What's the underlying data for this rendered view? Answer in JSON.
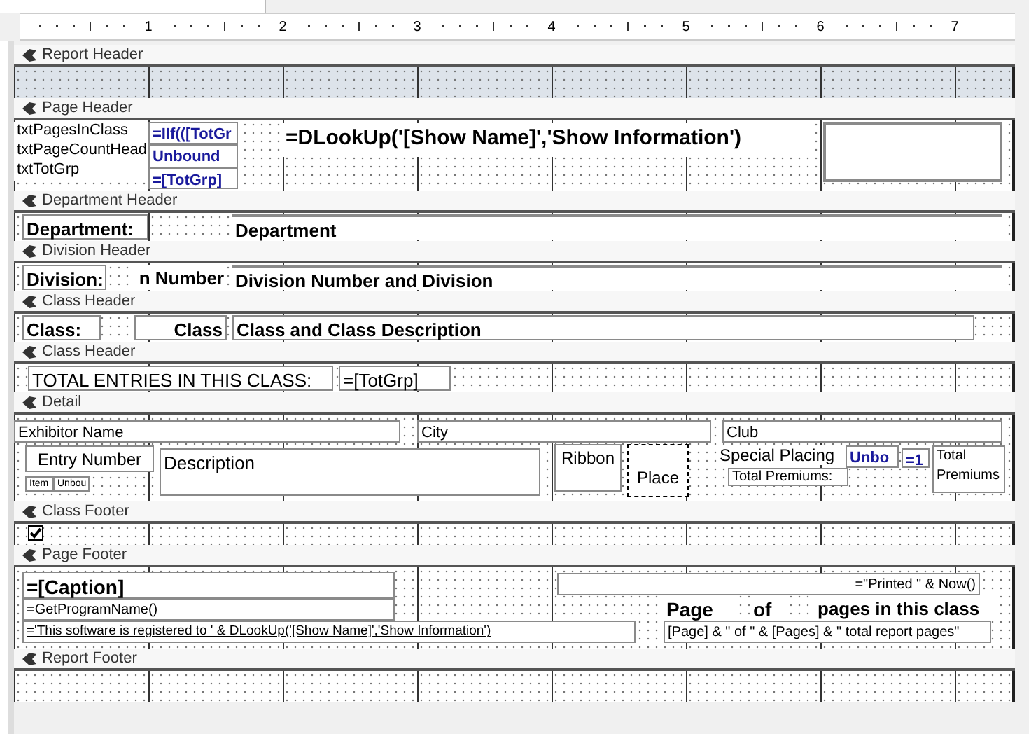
{
  "ruler": {
    "marks": [
      "1",
      "2",
      "3",
      "4",
      "5",
      "6",
      "7"
    ]
  },
  "sections": [
    {
      "title": "Report Header",
      "shaded": true
    },
    {
      "title": "Page Header",
      "shaded": false,
      "controls": [
        {
          "kind": "label",
          "text": "txtPagesInClass"
        },
        {
          "kind": "label",
          "text": "txtPageCountHead"
        },
        {
          "kind": "label",
          "text": "txtTotGrp"
        },
        {
          "kind": "expression",
          "text": "=IIf(([TotGr"
        },
        {
          "kind": "expression",
          "text": "Unbound"
        },
        {
          "kind": "expression",
          "text": "=[TotGrp]"
        },
        {
          "kind": "textbox",
          "text": "=DLookUp('[Show Name]','Show Information')"
        },
        {
          "kind": "frame"
        }
      ]
    },
    {
      "title": "Department Header",
      "shaded": false,
      "controls": [
        {
          "kind": "label",
          "text": "Department:"
        },
        {
          "kind": "textbox",
          "text": "Department"
        }
      ]
    },
    {
      "title": "Division Header",
      "shaded": false,
      "controls": [
        {
          "kind": "label",
          "text": "Division:"
        },
        {
          "kind": "textbox",
          "text": "n Number"
        },
        {
          "kind": "textbox",
          "text": "Division Number and Division"
        }
      ]
    },
    {
      "title": "Class Header",
      "shaded": false,
      "controls": [
        {
          "kind": "label",
          "text": "Class:"
        },
        {
          "kind": "textbox",
          "text": "Class"
        },
        {
          "kind": "textbox",
          "text": "Class and Class Description"
        }
      ]
    },
    {
      "title": "Class Header",
      "shaded": false,
      "controls": [
        {
          "kind": "label",
          "text": "TOTAL ENTRIES IN THIS CLASS:"
        },
        {
          "kind": "textbox",
          "text": "=[TotGrp]"
        }
      ]
    },
    {
      "title": "Detail",
      "shaded": false,
      "controls": [
        {
          "kind": "textbox",
          "text": "Exhibitor Name"
        },
        {
          "kind": "textbox",
          "text": "City"
        },
        {
          "kind": "textbox",
          "text": "Club"
        },
        {
          "kind": "label",
          "text": "Entry Number"
        },
        {
          "kind": "label",
          "text": "Item"
        },
        {
          "kind": "textbox",
          "text": "Unbou"
        },
        {
          "kind": "textbox",
          "text": "Description"
        },
        {
          "kind": "label",
          "text": "Ribbon"
        },
        {
          "kind": "label",
          "text": "Place"
        },
        {
          "kind": "label",
          "text": "Special Placing"
        },
        {
          "kind": "label",
          "text": "Total Premiums:"
        },
        {
          "kind": "expression",
          "text": "Unbo"
        },
        {
          "kind": "expression",
          "text": "=1"
        },
        {
          "kind": "textbox",
          "text": "Total Premiums"
        }
      ]
    },
    {
      "title": "Class Footer",
      "shaded": false,
      "controls": [
        {
          "kind": "checkbox",
          "checked": true
        }
      ]
    },
    {
      "title": "Page Footer",
      "shaded": false,
      "controls": [
        {
          "kind": "textbox",
          "text": "=[Caption]"
        },
        {
          "kind": "textbox",
          "text": "=GetProgramName()"
        },
        {
          "kind": "textbox",
          "text": "='This software is registered to ' & DLookUp('[Show Name]','Show Information')"
        },
        {
          "kind": "textbox",
          "text": "=\"Printed \" & Now()"
        },
        {
          "kind": "label",
          "text": "Page"
        },
        {
          "kind": "label",
          "text": "of"
        },
        {
          "kind": "label",
          "text": "pages in this class"
        },
        {
          "kind": "textbox",
          "text": "[Page] & \" of \" & [Pages] & \" total report pages\""
        }
      ]
    },
    {
      "title": "Report Footer",
      "shaded": false
    }
  ]
}
